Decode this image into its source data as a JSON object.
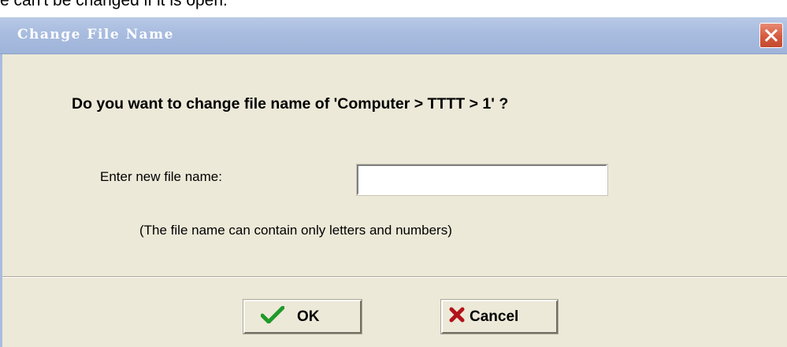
{
  "background_text": "e can't be changed if it is open.",
  "dialog": {
    "title": "Change File Name",
    "close_icon": "close-x-icon",
    "question": "Do you want to change file name of 'Computer > TTTT > 1' ?",
    "prompt_label": "Enter new file name:",
    "input_value": "",
    "hint": "(The file name can contain only letters and numbers)",
    "buttons": {
      "ok": {
        "label": "OK",
        "icon": "green-checkmark-icon"
      },
      "cancel": {
        "label": "Cancel",
        "icon": "red-x-icon"
      }
    }
  },
  "colors": {
    "titlebar": "#a8bcdf",
    "dialog_bg": "#ece9d8",
    "close_button": "#d55a3e",
    "ok_check": "#1f9a2a",
    "cancel_x": "#b3121a"
  }
}
